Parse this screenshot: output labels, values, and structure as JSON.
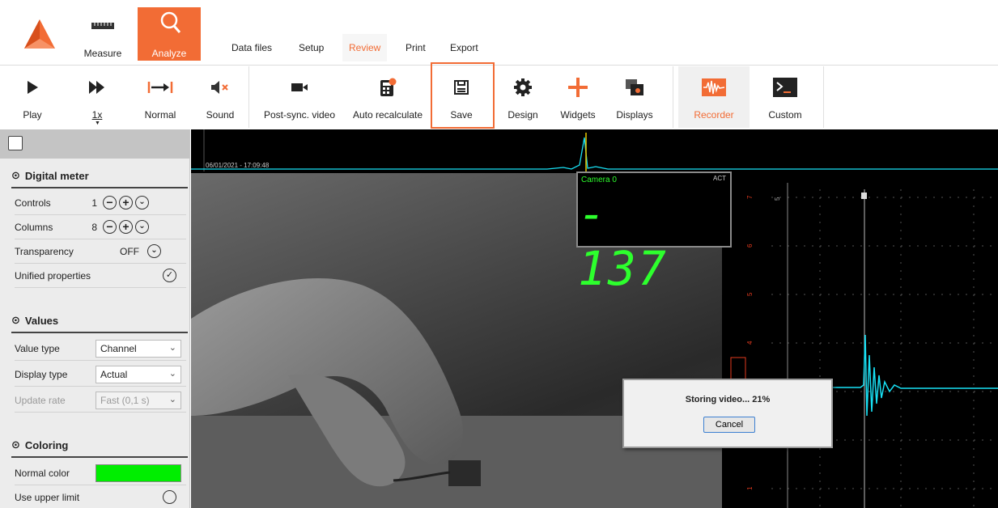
{
  "modes": {
    "measure": "Measure",
    "analyze": "Analyze"
  },
  "tabs": [
    "Data files",
    "Setup",
    "Review",
    "Print",
    "Export"
  ],
  "toolbar": {
    "play": "Play",
    "speed": "1x",
    "normal": "Normal",
    "sound": "Sound",
    "post_sync_video": "Post-sync. video",
    "auto_recalculate": "Auto recalculate",
    "save": "Save",
    "design": "Design",
    "widgets": "Widgets",
    "displays": "Displays",
    "recorder": "Recorder",
    "custom": "Custom"
  },
  "panel": {
    "digital_meter": {
      "title": "Digital meter",
      "controls_label": "Controls",
      "controls_value": "1",
      "columns_label": "Columns",
      "columns_value": "8",
      "transparency_label": "Transparency",
      "transparency_value": "OFF",
      "unified_label": "Unified properties"
    },
    "values": {
      "title": "Values",
      "value_type_label": "Value type",
      "value_type": "Channel",
      "display_type_label": "Display type",
      "display_type": "Actual",
      "update_rate_label": "Update rate",
      "update_rate": "Fast (0,1 s)"
    },
    "coloring": {
      "title": "Coloring",
      "normal_color_label": "Normal color",
      "normal_color": "#00ee00",
      "upper_limit_label": "Use upper limit"
    }
  },
  "timeline": {
    "timestamp": "06/01/2021 - 17:09:48"
  },
  "digital_meter_widget": {
    "label": "Camera 0",
    "status": "ACT",
    "value": "- 137"
  },
  "dialog": {
    "text": "Storing video... 21%",
    "progress_percent": 21,
    "cancel": "Cancel"
  },
  "colors": {
    "accent": "#f26c35",
    "signal": "#18e1f5",
    "meter": "#2dff2d"
  }
}
